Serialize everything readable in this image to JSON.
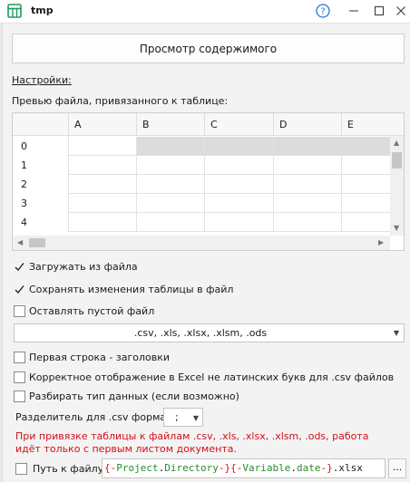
{
  "window": {
    "title": "tmp",
    "help_icon": "question-circle-icon",
    "min_icon": "minimize-icon",
    "max_icon": "maximize-icon",
    "close_icon": "close-icon"
  },
  "view_button": "Просмотр содержимого",
  "settings_link": "Настройки:",
  "preview_label": "Превью файла, привязанного к таблице:",
  "grid": {
    "columns": [
      "A",
      "B",
      "C",
      "D",
      "E"
    ],
    "rows": [
      "0",
      "1",
      "2",
      "3",
      "4"
    ]
  },
  "options": {
    "load_from_file": {
      "label": "Загружать из файла",
      "checked": true
    },
    "save_changes": {
      "label": "Сохранять изменения таблицы в файл",
      "checked": true
    },
    "leave_empty": {
      "label": "Оставлять пустой файл",
      "checked": false
    }
  },
  "extensions_select": ".csv, .xls, .xlsx, .xlsm, .ods",
  "csv_options": {
    "first_row_headers": {
      "label": "Первая строка - заголовки",
      "checked": false
    },
    "excel_non_latin": {
      "label": "Корректное отображение в Excel не латинских букв для .csv файлов",
      "checked": false
    },
    "parse_types": {
      "label": "Разбирать тип данных (если возможно)",
      "checked": false
    }
  },
  "separator": {
    "label": "Разделитель для .csv формата",
    "value": ";"
  },
  "warning": "При привязке таблицы к файлам .csv, .xls, .xlsx, .xlsm, .ods, работа идёт только с первым листом документа.",
  "path": {
    "label": "Путь к файлу",
    "tokens": [
      {
        "t": "{-",
        "k": "brace"
      },
      {
        "t": "Project",
        "k": "kw"
      },
      {
        "t": ".",
        "k": "dot"
      },
      {
        "t": "Directory",
        "k": "kw"
      },
      {
        "t": "-}",
        "k": "brace"
      },
      {
        "t": "{-",
        "k": "brace"
      },
      {
        "t": "Variable",
        "k": "kw"
      },
      {
        "t": ".",
        "k": "dot"
      },
      {
        "t": "date",
        "k": "kw"
      },
      {
        "t": "-}",
        "k": "brace"
      },
      {
        "t": ".xlsx",
        "k": "dot"
      }
    ],
    "browse_button": "..."
  },
  "colors": {
    "warning_text": "#d0101b",
    "template_keyword": "#2a8a2a",
    "template_brace": "#d0101b",
    "grid_shade": "#dcdcdc",
    "app_icon": "#1f9a62",
    "help_icon": "#2b78d4"
  }
}
